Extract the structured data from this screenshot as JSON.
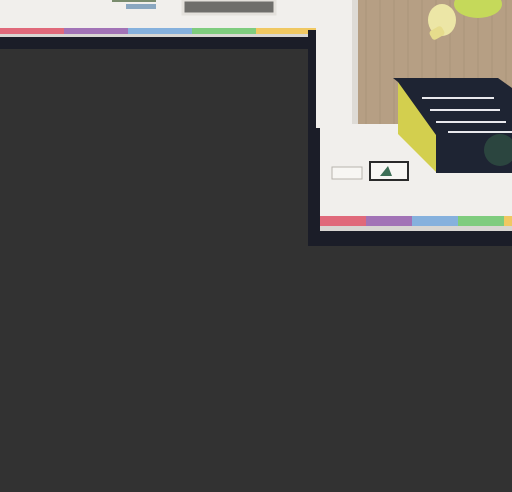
{
  "scene": {
    "colors": {
      "background": "#323232",
      "wall_white": "#f1efec",
      "floor_wood": "#b69f84",
      "shelf_yellow": "#d3cf4e",
      "shelf_dark": "#1e2433",
      "chair_green": "#c5d95a",
      "chair_cream": "#ece6a6",
      "rug_gray": "#6f6e6b",
      "frame_dark": "#1b1d28"
    },
    "stripe_colors": [
      "#e0697a",
      "#a273b6",
      "#86b1dd",
      "#7fcc7e",
      "#f0c862"
    ]
  }
}
